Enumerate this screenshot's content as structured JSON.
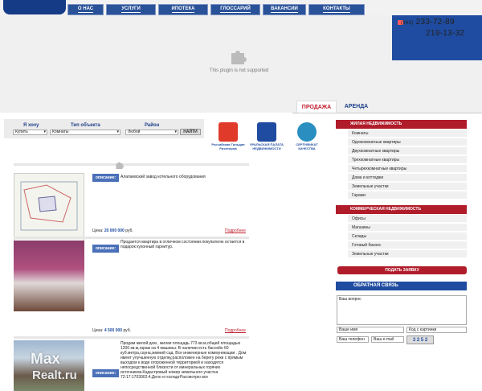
{
  "nav": {
    "items": [
      "О НАС",
      "УСЛУГИ",
      "ИПОТЕКА",
      "ГЛОССАРИЙ",
      "ВАКАНСИИ",
      "КОНТАКТЫ"
    ]
  },
  "plugin": {
    "message": "This plugin is not supported"
  },
  "contact": {
    "phone_code": "(343)",
    "phone1": "233-72-89",
    "phone2": "219-13-32"
  },
  "tabs": {
    "sale": "ПРОДАЖА",
    "rent": "АРЕНДА"
  },
  "search": {
    "labels": [
      "Я хочу",
      "Тип объекта",
      "Район"
    ],
    "values": [
      "Купить",
      "Комнаты",
      "Любой"
    ],
    "button": "НАЙТИ"
  },
  "partners": [
    {
      "caption": "Российская Гильдия Риэлторов",
      "color": "#e03a2a"
    },
    {
      "caption": "УРАЛЬСКАЯ ПАЛАТА НЕДВИЖИМОСТИ",
      "color": "#1f4ca0"
    },
    {
      "caption": "СЕРТИФИКАТ КАЧЕСТВА",
      "color": "#2a8fc0"
    }
  ],
  "listings": [
    {
      "label": "описание:",
      "description": "Алапаевский завод котельного оборудования",
      "price_label": "Цена:",
      "price": "20 000 000",
      "currency": "руб.",
      "more": "Подробнее"
    },
    {
      "label": "описание:",
      "description": "Продается квартира в отличном состоянии.покупателю остается в подарок кухонный гарнитур.",
      "price_label": "Цена:",
      "price": "4 500 000",
      "currency": "руб.",
      "more": "Подробнее"
    },
    {
      "label": "описание:",
      "description": "Продам жилой дом , жилая площадь 773 кв.м,общей площадью 1200 кв.м,гараж на 4 машины. В наличии есть бассейн 60 куб.метра,сауна,зимний сад. Все инженерные коммуникации . Дом имеет улучшенную отделку,расположен на берегу реки с прямым выходом к воде огороженной территорией и находится непосредственной близости от минеральных горячих источников.Кадастровый номер земельного участка 72:17:1703002:4.Дело и госпадтРассмотрю все"
    }
  ],
  "sidebar": {
    "residential_title": "ЖИЛАЯ НЕДВИЖИМОСТЬ",
    "residential": [
      "Комнаты",
      "Однокомнатные квартиры",
      "Двухкомнатные квартиры",
      "Трехкомнатные квартиры",
      "Четырехкомнатные квартиры",
      "Дома и коттеджи",
      "Земельные участки",
      "Гаражи"
    ],
    "commercial_title": "КОММЕРЧЕСКАЯ НЕДВИЖИМОСТЬ",
    "commercial": [
      "Офисы",
      "Магазины",
      "Склады",
      "Готовый бизнес",
      "Земельные участки"
    ],
    "submit": "ПОДАТЬ ЗАЯВКУ"
  },
  "feedback": {
    "title": "ОБРАТНАЯ СВЯЗЬ",
    "question_placeholder": "Ваш вопрос",
    "name_placeholder": "Ваше имя",
    "code_placeholder": "Код с картинки",
    "phone_placeholder": "Ваш телефон",
    "email_placeholder": "Ваш e-mail",
    "captcha": "3 2 5 2"
  },
  "watermark": {
    "line1": "Max",
    "line2": "Realt.ru"
  }
}
